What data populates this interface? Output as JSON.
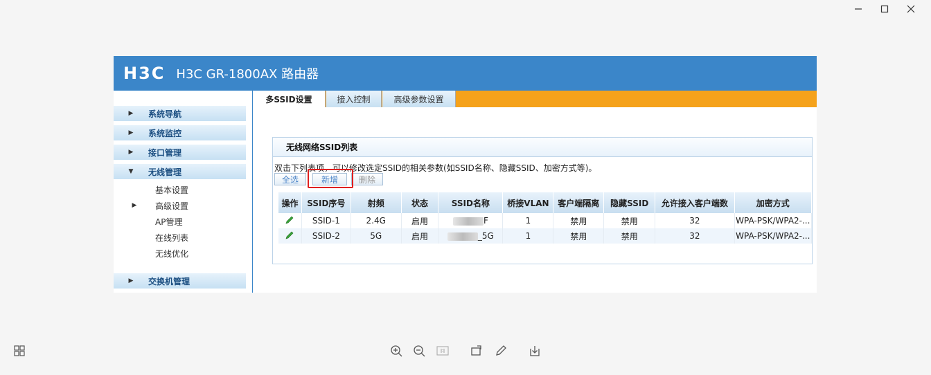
{
  "header": {
    "logo": "H3C",
    "product_title": "H3C GR-1800AX 路由器"
  },
  "nav": {
    "items": [
      {
        "label": "系统导航"
      },
      {
        "label": "系统监控"
      },
      {
        "label": "接口管理"
      },
      {
        "label": "无线管理"
      },
      {
        "label": "交换机管理"
      }
    ],
    "sub_items": [
      {
        "label": "基本设置"
      },
      {
        "label": "高级设置"
      },
      {
        "label": "AP管理"
      },
      {
        "label": "在线列表"
      },
      {
        "label": "无线优化"
      }
    ]
  },
  "tabs": [
    {
      "label": "多SSID设置"
    },
    {
      "label": "接入控制"
    },
    {
      "label": "高级参数设置"
    }
  ],
  "panel": {
    "title": "无线网络SSID列表",
    "hint": "双击下列表项，可以修改选定SSID的相关参数(如SSID名称、隐藏SSID、加密方式等)。",
    "buttons": {
      "select_all": "全选",
      "add": "新增",
      "delete": "删除"
    }
  },
  "table": {
    "headers": [
      "操作",
      "SSID序号",
      "射频",
      "状态",
      "SSID名称",
      "桥接VLAN",
      "客户端隔离",
      "隐藏SSID",
      "允许接入客户端数",
      "加密方式"
    ],
    "rows": [
      {
        "index": "SSID-1",
        "band": "2.4G",
        "status": "启用",
        "name_suffix": "F",
        "vlan": "1",
        "isolation": "禁用",
        "hidden": "禁用",
        "max_clients": "32",
        "encryption": "WPA-PSK/WPA2-..."
      },
      {
        "index": "SSID-2",
        "band": "5G",
        "status": "启用",
        "name_suffix": "_5G",
        "vlan": "1",
        "isolation": "禁用",
        "hidden": "禁用",
        "max_clients": "32",
        "encryption": "WPA-PSK/WPA2-..."
      }
    ]
  },
  "colors": {
    "banner": "#3b86c9",
    "tabbar": "#f5a21b",
    "highlight": "#e02020"
  },
  "icons": [
    "minimize-icon",
    "maximize-icon",
    "close-icon",
    "grid-icon",
    "zoom-in-icon",
    "zoom-out-icon",
    "actual-size-icon",
    "rotate-icon",
    "edit-icon",
    "save-icon",
    "pencil-icon"
  ]
}
